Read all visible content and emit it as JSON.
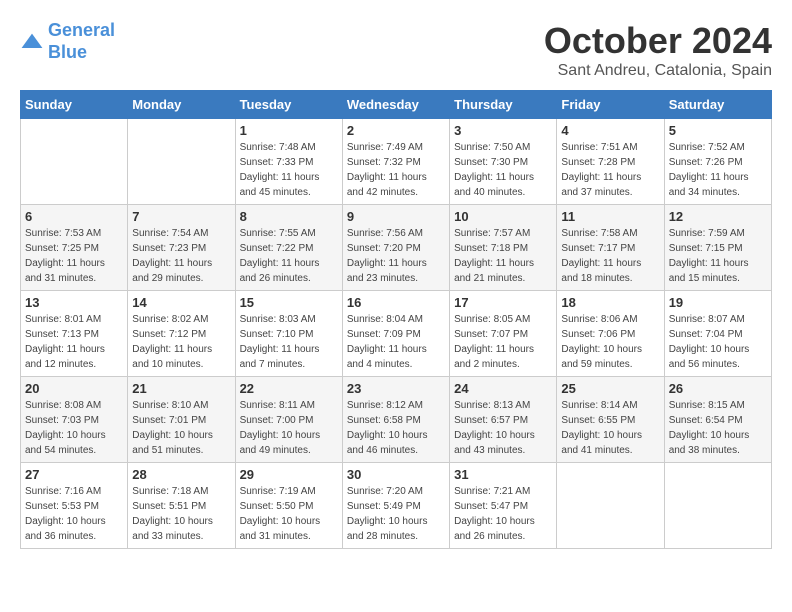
{
  "header": {
    "logo_line1": "General",
    "logo_line2": "Blue",
    "month": "October 2024",
    "location": "Sant Andreu, Catalonia, Spain"
  },
  "weekdays": [
    "Sunday",
    "Monday",
    "Tuesday",
    "Wednesday",
    "Thursday",
    "Friday",
    "Saturday"
  ],
  "weeks": [
    [
      {
        "day": "",
        "sunrise": "",
        "sunset": "",
        "daylight": ""
      },
      {
        "day": "",
        "sunrise": "",
        "sunset": "",
        "daylight": ""
      },
      {
        "day": "1",
        "sunrise": "Sunrise: 7:48 AM",
        "sunset": "Sunset: 7:33 PM",
        "daylight": "Daylight: 11 hours and 45 minutes."
      },
      {
        "day": "2",
        "sunrise": "Sunrise: 7:49 AM",
        "sunset": "Sunset: 7:32 PM",
        "daylight": "Daylight: 11 hours and 42 minutes."
      },
      {
        "day": "3",
        "sunrise": "Sunrise: 7:50 AM",
        "sunset": "Sunset: 7:30 PM",
        "daylight": "Daylight: 11 hours and 40 minutes."
      },
      {
        "day": "4",
        "sunrise": "Sunrise: 7:51 AM",
        "sunset": "Sunset: 7:28 PM",
        "daylight": "Daylight: 11 hours and 37 minutes."
      },
      {
        "day": "5",
        "sunrise": "Sunrise: 7:52 AM",
        "sunset": "Sunset: 7:26 PM",
        "daylight": "Daylight: 11 hours and 34 minutes."
      }
    ],
    [
      {
        "day": "6",
        "sunrise": "Sunrise: 7:53 AM",
        "sunset": "Sunset: 7:25 PM",
        "daylight": "Daylight: 11 hours and 31 minutes."
      },
      {
        "day": "7",
        "sunrise": "Sunrise: 7:54 AM",
        "sunset": "Sunset: 7:23 PM",
        "daylight": "Daylight: 11 hours and 29 minutes."
      },
      {
        "day": "8",
        "sunrise": "Sunrise: 7:55 AM",
        "sunset": "Sunset: 7:22 PM",
        "daylight": "Daylight: 11 hours and 26 minutes."
      },
      {
        "day": "9",
        "sunrise": "Sunrise: 7:56 AM",
        "sunset": "Sunset: 7:20 PM",
        "daylight": "Daylight: 11 hours and 23 minutes."
      },
      {
        "day": "10",
        "sunrise": "Sunrise: 7:57 AM",
        "sunset": "Sunset: 7:18 PM",
        "daylight": "Daylight: 11 hours and 21 minutes."
      },
      {
        "day": "11",
        "sunrise": "Sunrise: 7:58 AM",
        "sunset": "Sunset: 7:17 PM",
        "daylight": "Daylight: 11 hours and 18 minutes."
      },
      {
        "day": "12",
        "sunrise": "Sunrise: 7:59 AM",
        "sunset": "Sunset: 7:15 PM",
        "daylight": "Daylight: 11 hours and 15 minutes."
      }
    ],
    [
      {
        "day": "13",
        "sunrise": "Sunrise: 8:01 AM",
        "sunset": "Sunset: 7:13 PM",
        "daylight": "Daylight: 11 hours and 12 minutes."
      },
      {
        "day": "14",
        "sunrise": "Sunrise: 8:02 AM",
        "sunset": "Sunset: 7:12 PM",
        "daylight": "Daylight: 11 hours and 10 minutes."
      },
      {
        "day": "15",
        "sunrise": "Sunrise: 8:03 AM",
        "sunset": "Sunset: 7:10 PM",
        "daylight": "Daylight: 11 hours and 7 minutes."
      },
      {
        "day": "16",
        "sunrise": "Sunrise: 8:04 AM",
        "sunset": "Sunset: 7:09 PM",
        "daylight": "Daylight: 11 hours and 4 minutes."
      },
      {
        "day": "17",
        "sunrise": "Sunrise: 8:05 AM",
        "sunset": "Sunset: 7:07 PM",
        "daylight": "Daylight: 11 hours and 2 minutes."
      },
      {
        "day": "18",
        "sunrise": "Sunrise: 8:06 AM",
        "sunset": "Sunset: 7:06 PM",
        "daylight": "Daylight: 10 hours and 59 minutes."
      },
      {
        "day": "19",
        "sunrise": "Sunrise: 8:07 AM",
        "sunset": "Sunset: 7:04 PM",
        "daylight": "Daylight: 10 hours and 56 minutes."
      }
    ],
    [
      {
        "day": "20",
        "sunrise": "Sunrise: 8:08 AM",
        "sunset": "Sunset: 7:03 PM",
        "daylight": "Daylight: 10 hours and 54 minutes."
      },
      {
        "day": "21",
        "sunrise": "Sunrise: 8:10 AM",
        "sunset": "Sunset: 7:01 PM",
        "daylight": "Daylight: 10 hours and 51 minutes."
      },
      {
        "day": "22",
        "sunrise": "Sunrise: 8:11 AM",
        "sunset": "Sunset: 7:00 PM",
        "daylight": "Daylight: 10 hours and 49 minutes."
      },
      {
        "day": "23",
        "sunrise": "Sunrise: 8:12 AM",
        "sunset": "Sunset: 6:58 PM",
        "daylight": "Daylight: 10 hours and 46 minutes."
      },
      {
        "day": "24",
        "sunrise": "Sunrise: 8:13 AM",
        "sunset": "Sunset: 6:57 PM",
        "daylight": "Daylight: 10 hours and 43 minutes."
      },
      {
        "day": "25",
        "sunrise": "Sunrise: 8:14 AM",
        "sunset": "Sunset: 6:55 PM",
        "daylight": "Daylight: 10 hours and 41 minutes."
      },
      {
        "day": "26",
        "sunrise": "Sunrise: 8:15 AM",
        "sunset": "Sunset: 6:54 PM",
        "daylight": "Daylight: 10 hours and 38 minutes."
      }
    ],
    [
      {
        "day": "27",
        "sunrise": "Sunrise: 7:16 AM",
        "sunset": "Sunset: 5:53 PM",
        "daylight": "Daylight: 10 hours and 36 minutes."
      },
      {
        "day": "28",
        "sunrise": "Sunrise: 7:18 AM",
        "sunset": "Sunset: 5:51 PM",
        "daylight": "Daylight: 10 hours and 33 minutes."
      },
      {
        "day": "29",
        "sunrise": "Sunrise: 7:19 AM",
        "sunset": "Sunset: 5:50 PM",
        "daylight": "Daylight: 10 hours and 31 minutes."
      },
      {
        "day": "30",
        "sunrise": "Sunrise: 7:20 AM",
        "sunset": "Sunset: 5:49 PM",
        "daylight": "Daylight: 10 hours and 28 minutes."
      },
      {
        "day": "31",
        "sunrise": "Sunrise: 7:21 AM",
        "sunset": "Sunset: 5:47 PM",
        "daylight": "Daylight: 10 hours and 26 minutes."
      },
      {
        "day": "",
        "sunrise": "",
        "sunset": "",
        "daylight": ""
      },
      {
        "day": "",
        "sunrise": "",
        "sunset": "",
        "daylight": ""
      }
    ]
  ]
}
